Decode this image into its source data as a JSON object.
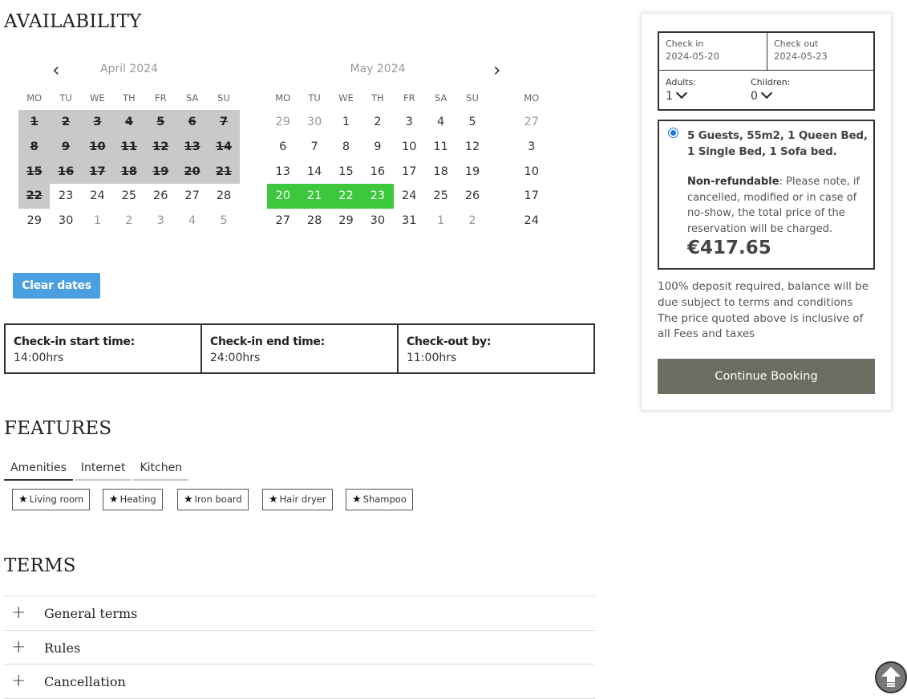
{
  "availability": {
    "title": "AVAILABILITY",
    "prev_label": "‹",
    "next_label": "›",
    "weekdays": [
      "MO",
      "TU",
      "WE",
      "TH",
      "FR",
      "SA",
      "SU"
    ],
    "april": {
      "title": "April 2024",
      "weeks": [
        [
          {
            "d": "1",
            "s": "past"
          },
          {
            "d": "2",
            "s": "past"
          },
          {
            "d": "3",
            "s": "past"
          },
          {
            "d": "4",
            "s": "past"
          },
          {
            "d": "5",
            "s": "past"
          },
          {
            "d": "6",
            "s": "past"
          },
          {
            "d": "7",
            "s": "past"
          }
        ],
        [
          {
            "d": "8",
            "s": "past"
          },
          {
            "d": "9",
            "s": "past"
          },
          {
            "d": "10",
            "s": "past"
          },
          {
            "d": "11",
            "s": "past"
          },
          {
            "d": "12",
            "s": "past"
          },
          {
            "d": "13",
            "s": "past"
          },
          {
            "d": "14",
            "s": "past"
          }
        ],
        [
          {
            "d": "15",
            "s": "past"
          },
          {
            "d": "16",
            "s": "past"
          },
          {
            "d": "17",
            "s": "past"
          },
          {
            "d": "18",
            "s": "past"
          },
          {
            "d": "19",
            "s": "past"
          },
          {
            "d": "20",
            "s": "past"
          },
          {
            "d": "21",
            "s": "past"
          }
        ],
        [
          {
            "d": "22",
            "s": "past"
          },
          {
            "d": "23",
            "s": ""
          },
          {
            "d": "24",
            "s": ""
          },
          {
            "d": "25",
            "s": ""
          },
          {
            "d": "26",
            "s": ""
          },
          {
            "d": "27",
            "s": ""
          },
          {
            "d": "28",
            "s": ""
          }
        ],
        [
          {
            "d": "29",
            "s": ""
          },
          {
            "d": "30",
            "s": ""
          },
          {
            "d": "1",
            "s": "out"
          },
          {
            "d": "2",
            "s": "out"
          },
          {
            "d": "3",
            "s": "out"
          },
          {
            "d": "4",
            "s": "out"
          },
          {
            "d": "5",
            "s": "out"
          }
        ]
      ]
    },
    "may": {
      "title": "May 2024",
      "weeks": [
        [
          {
            "d": "29",
            "s": "out"
          },
          {
            "d": "30",
            "s": "out"
          },
          {
            "d": "1",
            "s": ""
          },
          {
            "d": "2",
            "s": ""
          },
          {
            "d": "3",
            "s": ""
          },
          {
            "d": "4",
            "s": ""
          },
          {
            "d": "5",
            "s": ""
          }
        ],
        [
          {
            "d": "6",
            "s": ""
          },
          {
            "d": "7",
            "s": ""
          },
          {
            "d": "8",
            "s": ""
          },
          {
            "d": "9",
            "s": ""
          },
          {
            "d": "10",
            "s": ""
          },
          {
            "d": "11",
            "s": ""
          },
          {
            "d": "12",
            "s": ""
          }
        ],
        [
          {
            "d": "13",
            "s": ""
          },
          {
            "d": "14",
            "s": ""
          },
          {
            "d": "15",
            "s": ""
          },
          {
            "d": "16",
            "s": ""
          },
          {
            "d": "17",
            "s": ""
          },
          {
            "d": "18",
            "s": ""
          },
          {
            "d": "19",
            "s": ""
          }
        ],
        [
          {
            "d": "20",
            "s": "sel"
          },
          {
            "d": "21",
            "s": "sel"
          },
          {
            "d": "22",
            "s": "sel"
          },
          {
            "d": "23",
            "s": "sel"
          },
          {
            "d": "24",
            "s": ""
          },
          {
            "d": "25",
            "s": ""
          },
          {
            "d": "26",
            "s": ""
          }
        ],
        [
          {
            "d": "27",
            "s": ""
          },
          {
            "d": "28",
            "s": ""
          },
          {
            "d": "29",
            "s": ""
          },
          {
            "d": "30",
            "s": ""
          },
          {
            "d": "31",
            "s": ""
          },
          {
            "d": "1",
            "s": "out"
          },
          {
            "d": "2",
            "s": "out"
          }
        ]
      ]
    },
    "next_month_partial": {
      "weekday": "MO",
      "days": [
        {
          "d": "27",
          "s": "out"
        },
        {
          "d": "3",
          "s": ""
        },
        {
          "d": "10",
          "s": ""
        },
        {
          "d": "17",
          "s": ""
        },
        {
          "d": "24",
          "s": ""
        }
      ]
    },
    "clear_label": "Clear dates",
    "times": [
      {
        "label": "Check-in start time:",
        "value": "14:00hrs"
      },
      {
        "label": "Check-in end time:",
        "value": "24:00hrs"
      },
      {
        "label": "Check-out by:",
        "value": "11:00hrs"
      }
    ]
  },
  "features": {
    "title": "FEATURES",
    "tabs": [
      "Amenities",
      "Internet",
      "Kitchen"
    ],
    "items": [
      "Living room",
      "Heating",
      "Iron board",
      "Hair dryer",
      "Shampoo"
    ],
    "item_icon": "star-icon"
  },
  "terms": {
    "title": "TERMS",
    "items": [
      "General terms",
      "Rules",
      "Cancellation"
    ]
  },
  "booking": {
    "checkin_label": "Check in",
    "checkin_value": "2024-05-20",
    "checkout_label": "Check out",
    "checkout_value": "2024-05-23",
    "adults_label": "Adults:",
    "adults_value": "1",
    "children_label": "Children:",
    "children_value": "0",
    "offer_title": "5 Guests, 55m2, 1 Queen Bed, 1 Single Bed, 1 Sofa bed.",
    "policy_label": "Non-refundable",
    "policy_text": ": Please note, if cancelled, modified or in case of no-show, the total price of the reservation will be charged.",
    "price": "€417.65",
    "deposit_note": "100% deposit required, balance will be due subject to terms and conditions",
    "tax_note": "The price quoted above is inclusive of all Fees and taxes",
    "continue_label": "Continue Booking"
  },
  "colors": {
    "selected": "#3cc73c",
    "past": "#c9c9c9",
    "clear_button": "#4a9fe0",
    "continue_button": "#6c6c61"
  }
}
